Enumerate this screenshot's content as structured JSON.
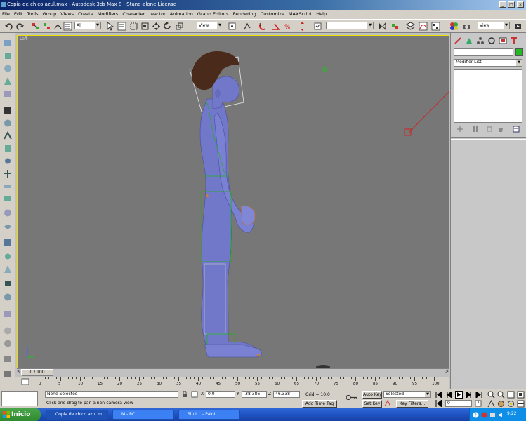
{
  "window": {
    "title": "Copia de chico azul.max - Autodesk 3ds Max 8 - Stand-alone License",
    "controls": [
      "_",
      "□",
      "x"
    ]
  },
  "menu": [
    "File",
    "Edit",
    "Tools",
    "Group",
    "Views",
    "Create",
    "Modifiers",
    "Character",
    "reactor",
    "Animation",
    "Graph Editors",
    "Rendering",
    "Customize",
    "MAXScript",
    "Help"
  ],
  "toolbar": {
    "selection_filter": "All",
    "reference_coord": "View",
    "named_selection": "",
    "render_view": "View"
  },
  "viewport": {
    "label": "Left"
  },
  "command_panel": {
    "modifier_list": "Modifier List",
    "name_field": "",
    "object_color": "#22bb22"
  },
  "time_slider": {
    "label": "0 / 100"
  },
  "trackbar": {
    "ticks": [
      "0",
      "5",
      "10",
      "15",
      "20",
      "25",
      "30",
      "35",
      "40",
      "45",
      "50",
      "55",
      "60",
      "65",
      "70",
      "75",
      "80",
      "85",
      "90",
      "95",
      "100"
    ]
  },
  "status": {
    "selection": "None Selected",
    "prompt": "Click and drag to pan a non-camera view",
    "x_label": "X",
    "x_value": "0.0",
    "y_label": "Y",
    "y_value": "-38.386",
    "z_label": "Z",
    "z_value": "46.338",
    "grid": "Grid = 10.0",
    "add_time_tag": "Add Time Tag",
    "auto_key": "Auto Key",
    "set_key": "Set Key",
    "key_mode": "Selected",
    "key_filters": "Key Filters...",
    "frame": "0"
  },
  "taskbar": {
    "start": "Inicio",
    "tasks": [
      "Copia de chico azul.m...",
      "M - RC",
      "Sin t... - Paint"
    ],
    "clock": "9:22"
  },
  "colors": {
    "viewport_bg": "#777777",
    "active_border": "#f0e000",
    "model": "#6a70c8",
    "hair": "#4a2a1a"
  }
}
